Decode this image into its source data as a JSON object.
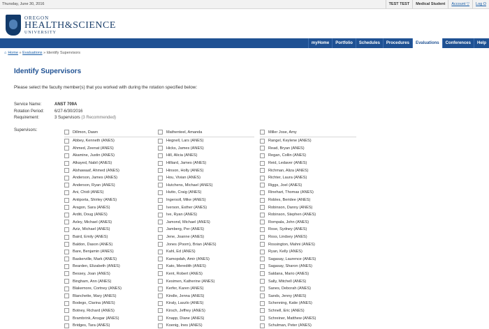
{
  "topbar": {
    "date": "Thursday, June 30, 2016",
    "user": "TEST TEST",
    "role": "Medical Student",
    "account": "Account ▽",
    "logout": "Log O"
  },
  "logo": {
    "line1": "OREGON",
    "line2": "HEALTH&SCIENCE",
    "line3": "UNIVERSITY"
  },
  "nav": {
    "tabs": [
      "myHome",
      "Portfolio",
      "Schedules",
      "Procedures",
      "Evaluations",
      "Conferences",
      "Help"
    ],
    "active": "Evaluations"
  },
  "breadcrumb": {
    "home": "Home",
    "sep1": "»",
    "evaluations": "Evaluations",
    "sep2": "»",
    "current": "Identify Supervisors"
  },
  "page": {
    "title": "Identify Supervisors",
    "instructions": "Please select the faculty member(s) that you worked with during the rotation specified below:",
    "service_label": "Service Name:",
    "service_value": "ANST 709A",
    "period_label": "Rotation Period:",
    "period_value": "6/27-6/30/2016",
    "req_label": "Requirement:",
    "req_value": "3 Supervisors",
    "req_rec": "(3 Recommended)",
    "supervisors_label": "Supervisors:"
  },
  "supervisors": {
    "col1": [
      "Dillmon, Dawn",
      "Abbey, Kenneth (ANES)",
      "Ahmed, Zeenat (ANES)",
      "Akamine, Justin (ANES)",
      "Alkayed, Nabil (ANES)",
      "Alshawaaf, Ahmed (ANES)",
      "Anderson, James (ANES)",
      "Anderson, Ryan (ANES)",
      "Ani, Chidi (ANES)",
      "Antiporta, Shirley (ANES)",
      "Aragon, Sara (ANES)",
      "Arditi, Doug (ANES)",
      "Axley, Michael (ANES)",
      "Aziz, Michael (ANES)",
      "Baird, Emily (ANES)",
      "Baldon, Dason (ANES)",
      "Bare, Benjamin (ANES)",
      "Baskerville, Mark (ANES)",
      "Bearden, Elizabeth (ANES)",
      "Bessey, Joan (ANES)",
      "Bingham, Ann (ANES)",
      "Blakemore, Cortney (ANES)",
      "Blanchette, Mary (ANES)",
      "Bodego, Clarina (ANES)",
      "Botney, Richard (ANES)",
      "Brambrink, Ansgar (ANES)",
      "Bridges, Tara (ANES)"
    ],
    "col2": [
      "Mathenteel, Amanda",
      "Hegnell, Lars (ANES)",
      "Hicks, James (ANES)",
      "Hill, Alicia (ANES)",
      "Hilliard, James (ANES)",
      "Hinson, Holly (ANES)",
      "Hou, Vivian (ANES)",
      "Hutchens, Michael (ANES)",
      "Hutto, Craig (ANES)",
      "Ingersoll, Mike (ANES)",
      "Iverson, Esther (ANES)",
      "Ive, Ryan (ANES)",
      "Jamond, Michael (ANES)",
      "Jamberg, Per (ANES)",
      "Jene, Joanne (ANES)",
      "Jones (Poom), Brian (ANES)",
      "Kahl, Ed (ANES)",
      "Kamopdah, Amir (ANES)",
      "Kato, Meredith (ANES)",
      "Kent, Robert (ANES)",
      "Kesimen, Katherine (ANES)",
      "Kerfer, Karen (ANES)",
      "Kindle, Jenna (ANES)",
      "Kiraly, Laszlo (ANES)",
      "Kirsch, Jeffrey (ANES)",
      "Knapp, Diane (ANES)",
      "Koenig, Ines (ANES)"
    ],
    "col3": [
      "Miller Jose, Amy",
      "Rangel, Keylene (ANES)",
      "Read, Bryan (ANES)",
      "Regan, Collin (ANES)",
      "Reid, Ledaver (ANES)",
      "Richman, Aliza (ANES)",
      "Richter, Laura (ANES)",
      "Riggs, Joel (ANES)",
      "Rinehart, Thomas (ANES)",
      "Robles, Beridee (ANES)",
      "Robinson, Danny (ANES)",
      "Robinson, Stephen (ANES)",
      "Rompala, John (ANES)",
      "Rose, Sydney (ANES)",
      "Ross, Lindsey (ANES)",
      "Rossington, Mahni (ANES)",
      "Ryan, Kelly (ANES)",
      "Sagasay, Laurence (ANES)",
      "Sagasay, Sharon (ANES)",
      "Saldana, Mario (ANES)",
      "Sally, Mitchell (ANES)",
      "Sanes, Deborah (ANES)",
      "Sands, Jenny (ANES)",
      "Schenning, Katie (ANES)",
      "Schnell, Eric (ANES)",
      "Schreiner, Matthew (ANES)",
      "Schulman, Peter (ANES)"
    ]
  }
}
